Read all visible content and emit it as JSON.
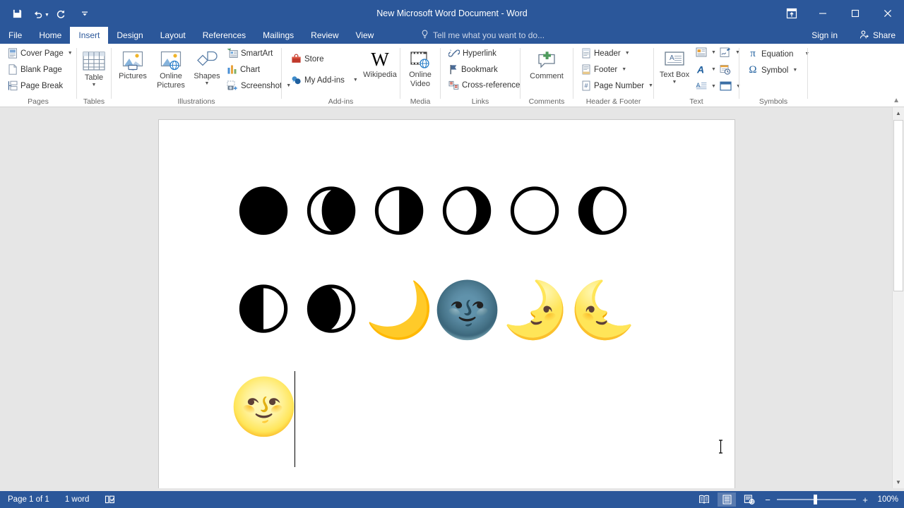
{
  "window": {
    "title": "New Microsoft Word Document - Word",
    "quick_access": [
      {
        "name": "save",
        "label": "Save",
        "glyph": "save-icon"
      },
      {
        "name": "undo",
        "label": "Undo",
        "glyph": "undo-icon"
      },
      {
        "name": "redo",
        "label": "Repeat",
        "glyph": "redo-icon"
      },
      {
        "name": "customize",
        "label": "Customize Quick Access Toolbar",
        "glyph": "chevron-down-icon"
      }
    ],
    "controls": {
      "ribbon_display": "Ribbon Display Options",
      "minimize": "Minimize",
      "maximize": "Restore Down",
      "close": "Close"
    }
  },
  "tabs": [
    {
      "label": "File",
      "active": false
    },
    {
      "label": "Home",
      "active": false
    },
    {
      "label": "Insert",
      "active": true
    },
    {
      "label": "Design",
      "active": false
    },
    {
      "label": "Layout",
      "active": false
    },
    {
      "label": "References",
      "active": false
    },
    {
      "label": "Mailings",
      "active": false
    },
    {
      "label": "Review",
      "active": false
    },
    {
      "label": "View",
      "active": false
    }
  ],
  "tellme": {
    "placeholder": "Tell me what you want to do..."
  },
  "account": {
    "signin": "Sign in",
    "share": "Share"
  },
  "ribbon": {
    "groups": [
      {
        "name": "pages",
        "label": "Pages",
        "items": [
          {
            "label": "Cover Page",
            "dropdown": true,
            "icon": "cover-page-icon"
          },
          {
            "label": "Blank Page",
            "dropdown": false,
            "icon": "blank-page-icon"
          },
          {
            "label": "Page Break",
            "dropdown": false,
            "icon": "page-break-icon"
          }
        ]
      },
      {
        "name": "tables",
        "label": "Tables",
        "items": [
          {
            "label": "Table",
            "dropdown": true,
            "icon": "table-icon"
          }
        ]
      },
      {
        "name": "illustrations",
        "label": "Illustrations",
        "items": [
          {
            "label": "Pictures",
            "dropdown": false,
            "icon": "pictures-icon"
          },
          {
            "label": "Online Pictures",
            "dropdown": false,
            "icon": "online-pictures-icon"
          },
          {
            "label": "Shapes",
            "dropdown": true,
            "icon": "shapes-icon"
          },
          {
            "label": "SmartArt",
            "dropdown": false,
            "icon": "smartart-icon"
          },
          {
            "label": "Chart",
            "dropdown": false,
            "icon": "chart-icon"
          },
          {
            "label": "Screenshot",
            "dropdown": true,
            "icon": "screenshot-icon"
          }
        ]
      },
      {
        "name": "addins",
        "label": "Add-ins",
        "items": [
          {
            "label": "Store",
            "dropdown": false,
            "icon": "store-icon"
          },
          {
            "label": "My Add-ins",
            "dropdown": true,
            "icon": "my-addins-icon"
          },
          {
            "label": "Wikipedia",
            "dropdown": false,
            "icon": "wikipedia-icon"
          }
        ]
      },
      {
        "name": "media",
        "label": "Media",
        "items": [
          {
            "label": "Online Video",
            "dropdown": false,
            "icon": "online-video-icon"
          }
        ]
      },
      {
        "name": "links",
        "label": "Links",
        "items": [
          {
            "label": "Hyperlink",
            "dropdown": false,
            "icon": "hyperlink-icon"
          },
          {
            "label": "Bookmark",
            "dropdown": false,
            "icon": "bookmark-icon"
          },
          {
            "label": "Cross-reference",
            "dropdown": false,
            "icon": "cross-reference-icon"
          }
        ]
      },
      {
        "name": "comments",
        "label": "Comments",
        "items": [
          {
            "label": "Comment",
            "dropdown": false,
            "icon": "comment-icon"
          }
        ]
      },
      {
        "name": "header-footer",
        "label": "Header & Footer",
        "items": [
          {
            "label": "Header",
            "dropdown": true,
            "icon": "header-icon"
          },
          {
            "label": "Footer",
            "dropdown": true,
            "icon": "footer-icon"
          },
          {
            "label": "Page Number",
            "dropdown": true,
            "icon": "page-number-icon"
          }
        ]
      },
      {
        "name": "text",
        "label": "Text",
        "items": [
          {
            "label": "Text Box",
            "dropdown": true,
            "icon": "text-box-icon"
          },
          {
            "label": "Quick Parts",
            "dropdown": true,
            "icon": "quick-parts-icon"
          },
          {
            "label": "WordArt",
            "dropdown": true,
            "icon": "wordart-icon"
          },
          {
            "label": "Drop Cap",
            "dropdown": true,
            "icon": "drop-cap-icon"
          },
          {
            "label": "Signature Line",
            "dropdown": true,
            "icon": "signature-line-icon"
          },
          {
            "label": "Date & Time",
            "dropdown": false,
            "icon": "date-time-icon"
          },
          {
            "label": "Object",
            "dropdown": true,
            "icon": "object-icon"
          }
        ]
      },
      {
        "name": "symbols",
        "label": "Symbols",
        "items": [
          {
            "label": "Equation",
            "dropdown": true,
            "icon": "equation-icon"
          },
          {
            "label": "Symbol",
            "dropdown": true,
            "icon": "symbol-icon"
          }
        ]
      }
    ],
    "collapse_label": "Collapse the Ribbon"
  },
  "document": {
    "glyph_rows": [
      {
        "name": "moon-phase-row-1",
        "glyphs": [
          {
            "char": "🌑",
            "name": "new-moon-glyph"
          },
          {
            "char": "🌘",
            "name": "waning-crescent-moon-glyph"
          },
          {
            "char": "🌗",
            "name": "last-quarter-moon-glyph"
          },
          {
            "char": "🌖",
            "name": "waning-gibbous-moon-glyph"
          },
          {
            "char": "🌕",
            "name": "full-moon-glyph"
          },
          {
            "char": "🌔",
            "name": "waxing-gibbous-moon-glyph"
          }
        ]
      },
      {
        "name": "moon-phase-row-2",
        "glyphs": [
          {
            "char": "🌓",
            "name": "first-quarter-moon-glyph"
          },
          {
            "char": "🌒",
            "name": "waxing-crescent-moon-glyph"
          },
          {
            "char": "🌙",
            "name": "crescent-moon-glyph"
          },
          {
            "char": "🌚",
            "name": "new-moon-face-glyph"
          },
          {
            "char": "🌛",
            "name": "first-quarter-moon-face-glyph"
          },
          {
            "char": "🌜",
            "name": "last-quarter-moon-face-glyph"
          }
        ]
      },
      {
        "name": "moon-phase-row-3",
        "glyphs": [
          {
            "char": "🌝",
            "name": "full-moon-face-glyph"
          }
        ]
      }
    ]
  },
  "statusbar": {
    "page": "Page 1 of 1",
    "words": "1 word",
    "proofing": "proofing-errors-icon",
    "views": [
      {
        "name": "read-mode",
        "label": "Read Mode",
        "active": false
      },
      {
        "name": "print-layout",
        "label": "Print Layout",
        "active": true
      },
      {
        "name": "web-layout",
        "label": "Web Layout",
        "active": false
      }
    ],
    "zoom_out": "−",
    "zoom_in": "+",
    "zoom_level": "100%"
  },
  "colors": {
    "brand": "#2b579a",
    "ribbon_bg": "#ffffff",
    "canvas": "#e6e6e6",
    "page": "#ffffff",
    "accent_text": "#2b579a"
  }
}
